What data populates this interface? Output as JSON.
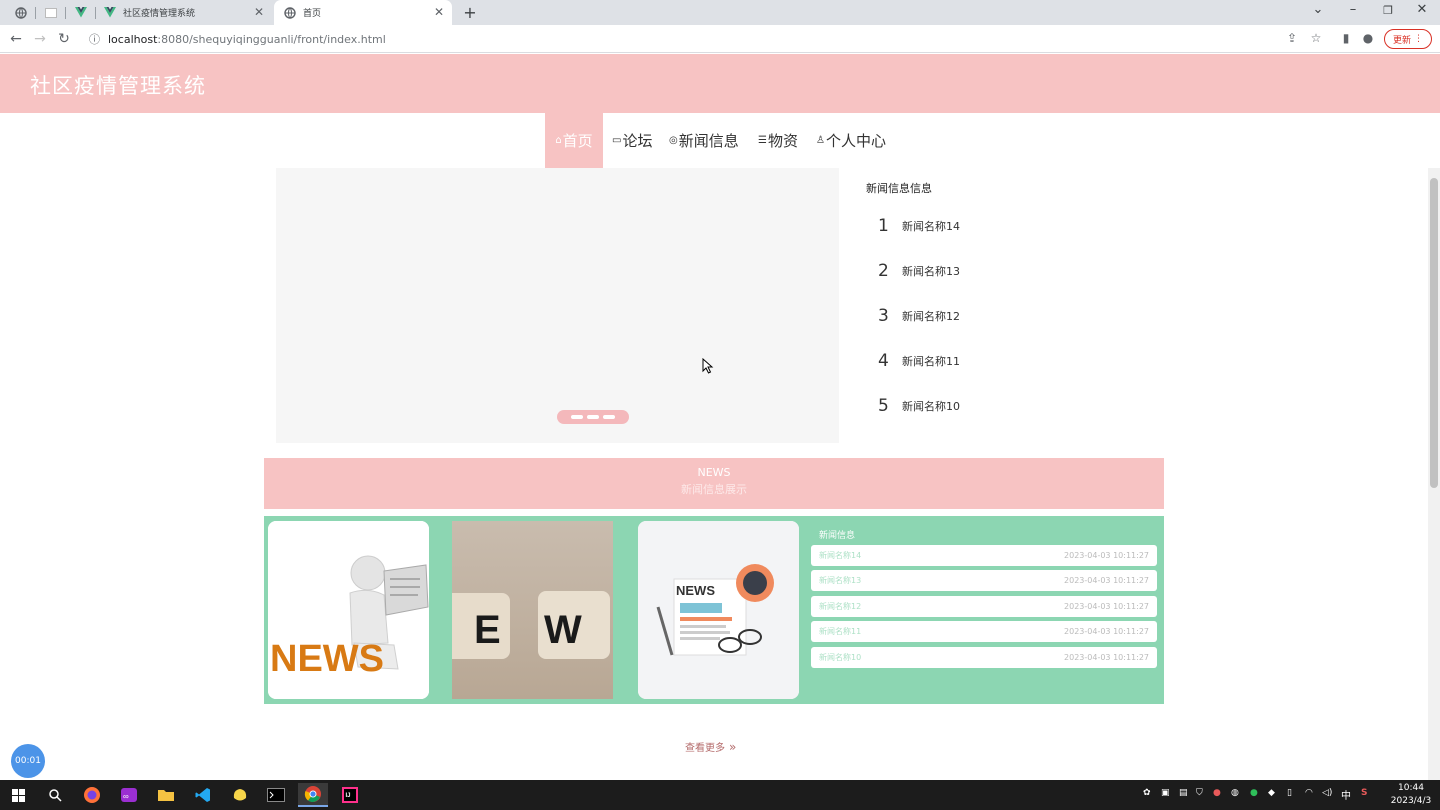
{
  "browser": {
    "tabs": [
      {
        "title": "",
        "icon": "globe-icon"
      },
      {
        "title": "",
        "icon": "blank-icon"
      },
      {
        "title": "",
        "icon": "vue-icon"
      },
      {
        "title": "社区疫情管理系统",
        "icon": "vue-icon"
      },
      {
        "title": "首页",
        "icon": "globe-icon"
      }
    ],
    "new_tab_label": "+",
    "url_host": "localhost",
    "url_path": ":8080/shequyiqingguanli/front/index.html",
    "update_label": "更新"
  },
  "site": {
    "title": "社区疫情管理系统",
    "header_right": "",
    "nav": [
      {
        "label": "首页",
        "icon": "home-icon"
      },
      {
        "label": "论坛",
        "icon": "chat-icon"
      },
      {
        "label": "新闻信息",
        "icon": "location-icon"
      },
      {
        "label": "物资",
        "icon": "list-icon"
      },
      {
        "label": "个人中心",
        "icon": "user-icon"
      }
    ]
  },
  "news_rank": {
    "title": "新闻信息信息",
    "items": [
      {
        "num": "1",
        "name": "新闻名称14"
      },
      {
        "num": "2",
        "name": "新闻名称13"
      },
      {
        "num": "3",
        "name": "新闻名称12"
      },
      {
        "num": "4",
        "name": "新闻名称11"
      },
      {
        "num": "5",
        "name": "新闻名称10"
      }
    ]
  },
  "news_section": {
    "banner_en": "NEWS",
    "banner_cn": "新闻信息展示",
    "cards": [
      {
        "image": "news-figure-image"
      },
      {
        "image": "news-blocks-image"
      },
      {
        "image": "news-paper-image"
      }
    ],
    "list_title": "新闻信息",
    "list": [
      {
        "name": "新闻名称14",
        "date": "2023-04-03 10:11:27"
      },
      {
        "name": "新闻名称13",
        "date": "2023-04-03 10:11:27"
      },
      {
        "name": "新闻名称12",
        "date": "2023-04-03 10:11:27"
      },
      {
        "name": "新闻名称11",
        "date": "2023-04-03 10:11:27"
      },
      {
        "name": "新闻名称10",
        "date": "2023-04-03 10:11:27"
      }
    ],
    "more_label": "查看更多"
  },
  "timer": "00:01",
  "taskbar": {
    "time": "10:44",
    "date": "2023/4/3",
    "ime": "中"
  },
  "colors": {
    "accent_pink": "#f7c3c3",
    "accent_green": "#8cd6b2"
  }
}
